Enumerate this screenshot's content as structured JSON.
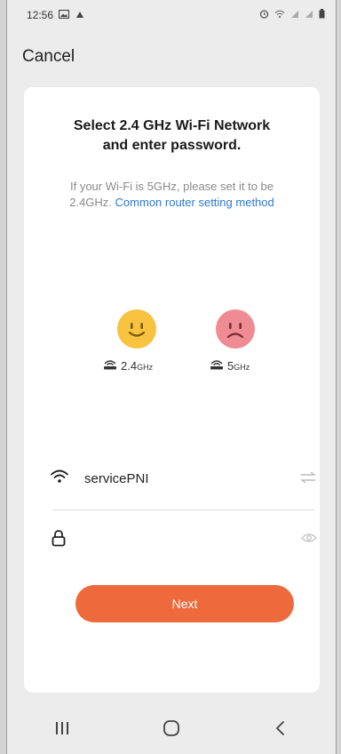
{
  "status_bar": {
    "time": "12:56",
    "left_icons": [
      "gallery-icon",
      "cloud-icon"
    ],
    "right_icons": [
      "alarm-icon",
      "wifi-icon",
      "signal-icon",
      "signal-icon",
      "battery-icon"
    ]
  },
  "nav": {
    "cancel_label": "Cancel"
  },
  "card": {
    "title_line1": "Select 2.4 GHz Wi-Fi Network",
    "title_line2": "and enter password.",
    "subtitle_text": "If your Wi-Fi is 5GHz, please set it to be 2.4GHz.",
    "subtitle_link": "Common router setting method",
    "bands": [
      {
        "value": "2.4",
        "unit": "GHz",
        "face": "smiley-face-icon",
        "color": "#f7c341"
      },
      {
        "value": "5",
        "unit": "GHz",
        "face": "sad-face-icon",
        "color": "#ef8b92"
      }
    ],
    "wifi_field": {
      "value": "servicePNI",
      "icon": "wifi-icon",
      "trail_icon": "switch-network-icon"
    },
    "password_field": {
      "value": "",
      "icon": "lock-icon",
      "trail_icon": "eye-icon"
    },
    "next_label": "Next"
  },
  "system_nav": [
    "recent-apps-icon",
    "home-icon",
    "back-icon"
  ],
  "colors": {
    "accent": "#ee6a3c",
    "link": "#2d78d6",
    "background": "#ececec",
    "card": "#ffffff"
  }
}
